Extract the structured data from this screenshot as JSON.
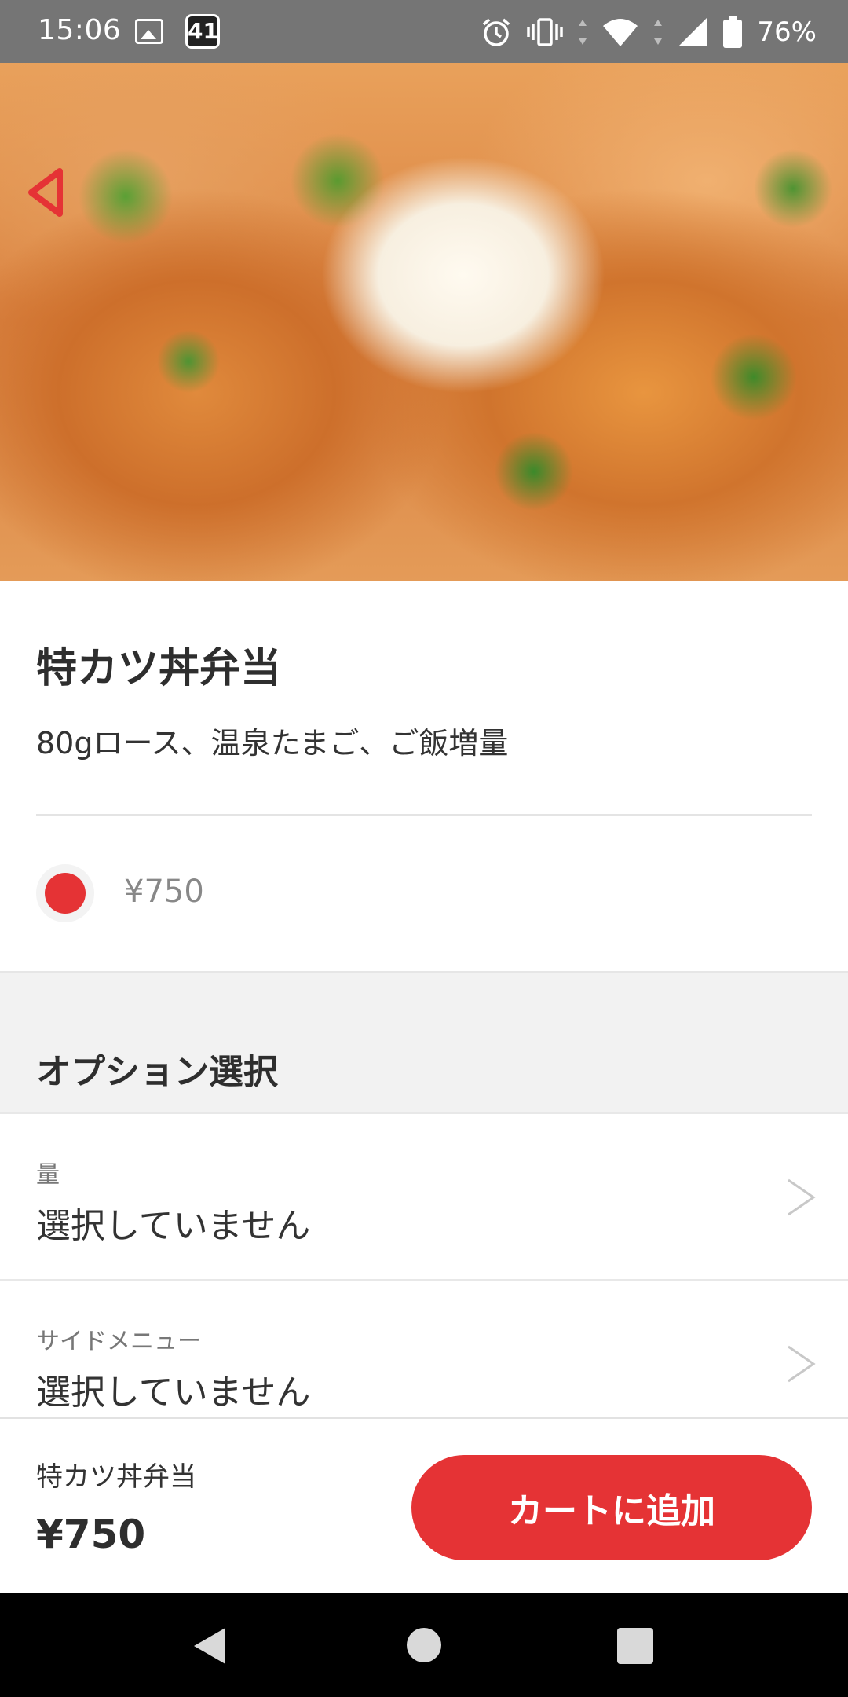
{
  "status_bar": {
    "time": "15:06",
    "notification_badge": "41",
    "battery_percent": "76%"
  },
  "product": {
    "name": "特カツ丼弁当",
    "description": "80gロース、温泉たまご、ご飯増量",
    "price_option": "¥750"
  },
  "options": {
    "header": "オプション選択",
    "items": [
      {
        "label": "量",
        "value": "選択していません"
      },
      {
        "label": "サイドメニュー",
        "value": "選択していません"
      }
    ]
  },
  "bottom_bar": {
    "name": "特カツ丼弁当",
    "price": "¥750",
    "add_to_cart_label": "カートに追加"
  },
  "colors": {
    "accent": "#e53335",
    "status_bar": "#757575"
  },
  "icons": [
    "back-arrow-icon",
    "image-icon",
    "alarm-icon",
    "vibrate-icon",
    "wifi-icon",
    "signal-icon",
    "battery-icon",
    "chevron-right-icon",
    "nav-back-icon",
    "nav-home-icon",
    "nav-recents-icon"
  ]
}
